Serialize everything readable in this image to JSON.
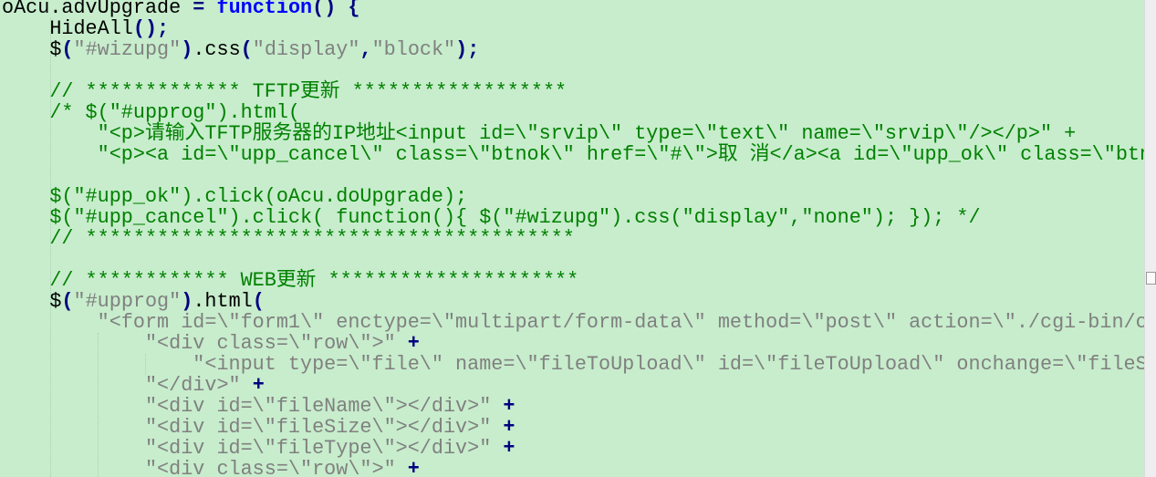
{
  "editor": {
    "colors": {
      "background": "#c7edcc",
      "plain": "#000000",
      "keyword": "#0000ff",
      "operator": "#000080",
      "string": "#808080",
      "comment": "#008000"
    },
    "lines": [
      [
        {
          "t": "p",
          "v": "oAcu.advUpgrade "
        },
        {
          "t": "o",
          "v": "="
        },
        {
          "t": "p",
          "v": " "
        },
        {
          "t": "k",
          "v": "function"
        },
        {
          "t": "o",
          "v": "()"
        },
        {
          "t": "p",
          "v": " "
        },
        {
          "t": "o",
          "v": "{"
        }
      ],
      [
        {
          "t": "p",
          "v": "    HideAll"
        },
        {
          "t": "o",
          "v": "();"
        }
      ],
      [
        {
          "t": "p",
          "v": "    $"
        },
        {
          "t": "o",
          "v": "("
        },
        {
          "t": "s",
          "v": "\"#wizupg\""
        },
        {
          "t": "o",
          "v": ")"
        },
        {
          "t": "p",
          "v": ".css"
        },
        {
          "t": "o",
          "v": "("
        },
        {
          "t": "s",
          "v": "\"display\""
        },
        {
          "t": "o",
          "v": ","
        },
        {
          "t": "s",
          "v": "\"block\""
        },
        {
          "t": "o",
          "v": ");"
        }
      ],
      [],
      [
        {
          "t": "c",
          "v": "    // ************* TFTP更新 ******************"
        }
      ],
      [
        {
          "t": "c",
          "v": "    /* $(\"#upprog\").html("
        }
      ],
      [
        {
          "t": "c",
          "v": "        \"<p>请输入TFTP服务器的IP地址<input id=\\\"srvip\\\" type=\\\"text\\\" name=\\\"srvip\\\"/></p>\" +"
        }
      ],
      [
        {
          "t": "c",
          "v": "        \"<p><a id=\\\"upp_cancel\\\" class=\\\"btnok\\\" href=\\\"#\\\">取 消</a><a id=\\\"upp_ok\\\" class=\\\"btn"
        }
      ],
      [],
      [
        {
          "t": "c",
          "v": "    $(\"#upp_ok\").click(oAcu.doUpgrade);"
        }
      ],
      [
        {
          "t": "c",
          "v": "    $(\"#upp_cancel\").click( function(){ $(\"#wizupg\").css(\"display\",\"none\"); }); */"
        }
      ],
      [
        {
          "t": "c",
          "v": "    // *****************************************"
        }
      ],
      [],
      [
        {
          "t": "c",
          "v": "    // ************ WEB更新 *********************"
        }
      ],
      [
        {
          "t": "p",
          "v": "    $"
        },
        {
          "t": "o",
          "v": "("
        },
        {
          "t": "s",
          "v": "\"#upprog\""
        },
        {
          "t": "o",
          "v": ")"
        },
        {
          "t": "p",
          "v": ".html"
        },
        {
          "t": "o",
          "v": "("
        }
      ],
      [
        {
          "t": "s",
          "v": "        \"<form id=\\\"form1\\\" enctype=\\\"multipart/form-data\\\" method=\\\"post\\\" action=\\\"./cgi-bin/cl"
        }
      ],
      [
        {
          "t": "s",
          "v": "            \"<div class=\\\"row\\\">\""
        },
        {
          "t": "p",
          "v": " "
        },
        {
          "t": "o",
          "v": "+"
        }
      ],
      [
        {
          "t": "s",
          "v": "                \"<input type=\\\"file\\\" name=\\\"fileToUpload\\\" id=\\\"fileToUpload\\\" onchange=\\\"fileSe"
        }
      ],
      [
        {
          "t": "s",
          "v": "            \"</div>\""
        },
        {
          "t": "p",
          "v": " "
        },
        {
          "t": "o",
          "v": "+"
        }
      ],
      [
        {
          "t": "s",
          "v": "            \"<div id=\\\"fileName\\\"></div>\""
        },
        {
          "t": "p",
          "v": " "
        },
        {
          "t": "o",
          "v": "+"
        }
      ],
      [
        {
          "t": "s",
          "v": "            \"<div id=\\\"fileSize\\\"></div>\""
        },
        {
          "t": "p",
          "v": " "
        },
        {
          "t": "o",
          "v": "+"
        }
      ],
      [
        {
          "t": "s",
          "v": "            \"<div id=\\\"fileType\\\"></div>\""
        },
        {
          "t": "p",
          "v": " "
        },
        {
          "t": "o",
          "v": "+"
        }
      ],
      [
        {
          "t": "s",
          "v": "            \"<div class=\\\"row\\\">\""
        },
        {
          "t": "p",
          "v": " "
        },
        {
          "t": "o",
          "v": "+"
        }
      ]
    ]
  }
}
